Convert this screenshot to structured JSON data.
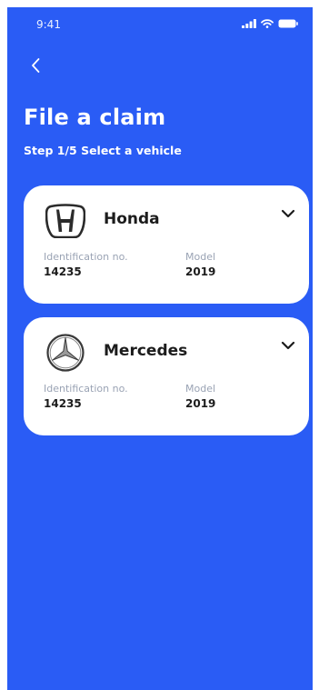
{
  "status_bar": {
    "time": "9:41"
  },
  "header": {
    "title": "File a claim",
    "subtitle": "Step 1/5 Select a vehicle"
  },
  "colors": {
    "background": "#2a5cf5",
    "card": "#ffffff",
    "label": "#9aa3b4",
    "text": "#1c1c1c"
  },
  "vehicles": [
    {
      "brand": "Honda",
      "logo": "honda-logo",
      "id_label": "Identification no.",
      "id_value": "14235",
      "model_label": "Model",
      "model_value": "2019"
    },
    {
      "brand": "Mercedes",
      "logo": "mercedes-logo",
      "id_label": "Identification no.",
      "id_value": "14235",
      "model_label": "Model",
      "model_value": "2019"
    }
  ]
}
